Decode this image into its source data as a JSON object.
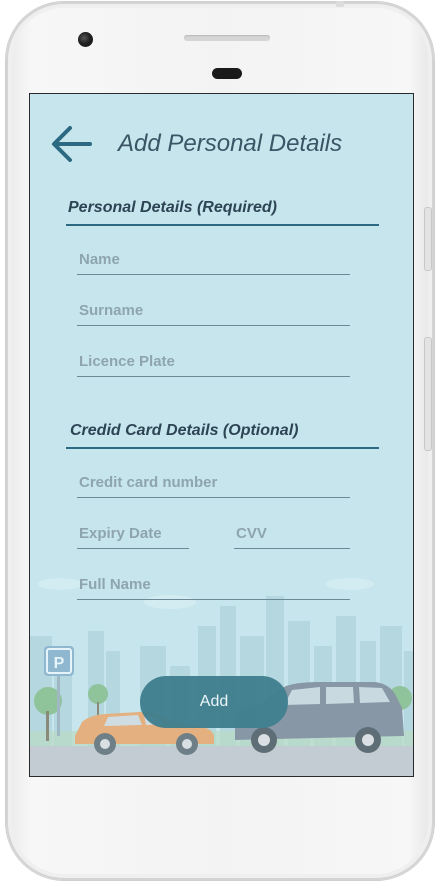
{
  "header": {
    "title": "Add Personal Details",
    "back_icon": "arrow-left-icon"
  },
  "personal_section": {
    "title": "Personal Details (Required)",
    "fields": {
      "name_placeholder": "Name",
      "surname_placeholder": "Surname",
      "licence_plate_placeholder": "Licence Plate"
    }
  },
  "card_section": {
    "title": "Credid Card Details (Optional)",
    "fields": {
      "card_number_placeholder": "Credit card number",
      "expiry_placeholder": "Expiry Date",
      "cvv_placeholder": "CVV",
      "full_name_placeholder": "Full Name"
    }
  },
  "actions": {
    "add_label": "Add"
  },
  "scene": {
    "parking_sign_letter": "P"
  },
  "colors": {
    "screen_bg": "#c6e5ec",
    "accent": "#2b6a82",
    "button": "#3f7e8e",
    "title_text": "#3b5566"
  }
}
